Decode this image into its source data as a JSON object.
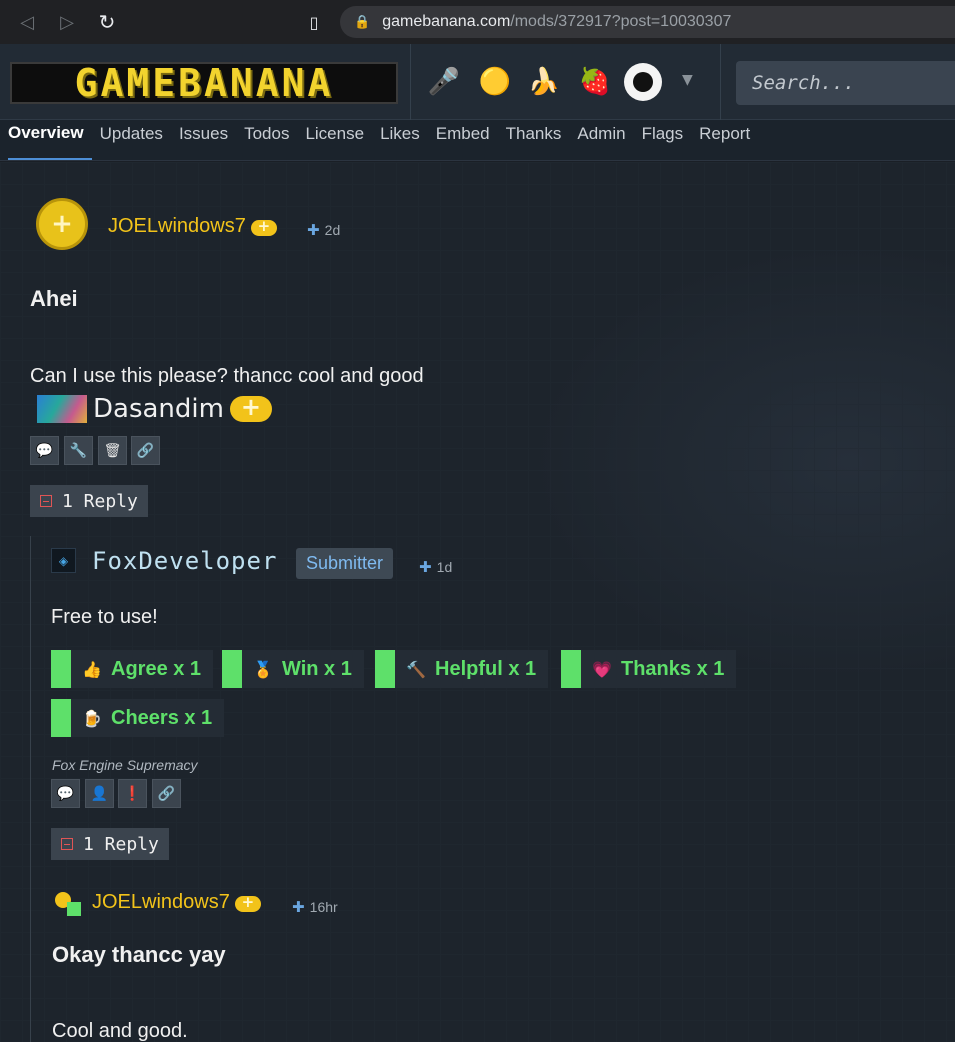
{
  "browser": {
    "url_host": "gamebanana.com",
    "url_path": "/mods/372917?post=10030307"
  },
  "header": {
    "logo_text": "GAMEBANANA",
    "search_placeholder": "Search..."
  },
  "tabs": [
    {
      "label": "Overview"
    },
    {
      "label": "Updates"
    },
    {
      "label": "Issues"
    },
    {
      "label": "Todos"
    },
    {
      "label": "License"
    },
    {
      "label": "Likes"
    },
    {
      "label": "Embed"
    },
    {
      "label": "Thanks"
    },
    {
      "label": "Admin"
    },
    {
      "label": "Flags"
    },
    {
      "label": "Report"
    }
  ],
  "post": {
    "author": "JOELwindows7",
    "time": "2d",
    "title": "Ahei",
    "body": "Can I use this please? thancc cool and good",
    "signature_name": "Dasandim",
    "reply_count_label": "1 Reply"
  },
  "reply": {
    "author": "FoxDeveloper",
    "role_badge": "Submitter",
    "time": "1d",
    "body": "Free to use!",
    "ratings": [
      {
        "label": "Agree x 1"
      },
      {
        "label": "Win x 1"
      },
      {
        "label": "Helpful x 1"
      },
      {
        "label": "Thanks x 1"
      },
      {
        "label": "Cheers x 1"
      }
    ],
    "signature": "Fox Engine Supremacy",
    "reply_count_label": "1 Reply"
  },
  "reply2": {
    "author": "JOELwindows7",
    "time": "16hr",
    "title": "Okay thancc yay",
    "body": "Cool and good."
  },
  "colors": {
    "accent_yellow": "#f2c31a",
    "rating_green": "#5ee06a",
    "link_blue": "#7fbaf0"
  }
}
